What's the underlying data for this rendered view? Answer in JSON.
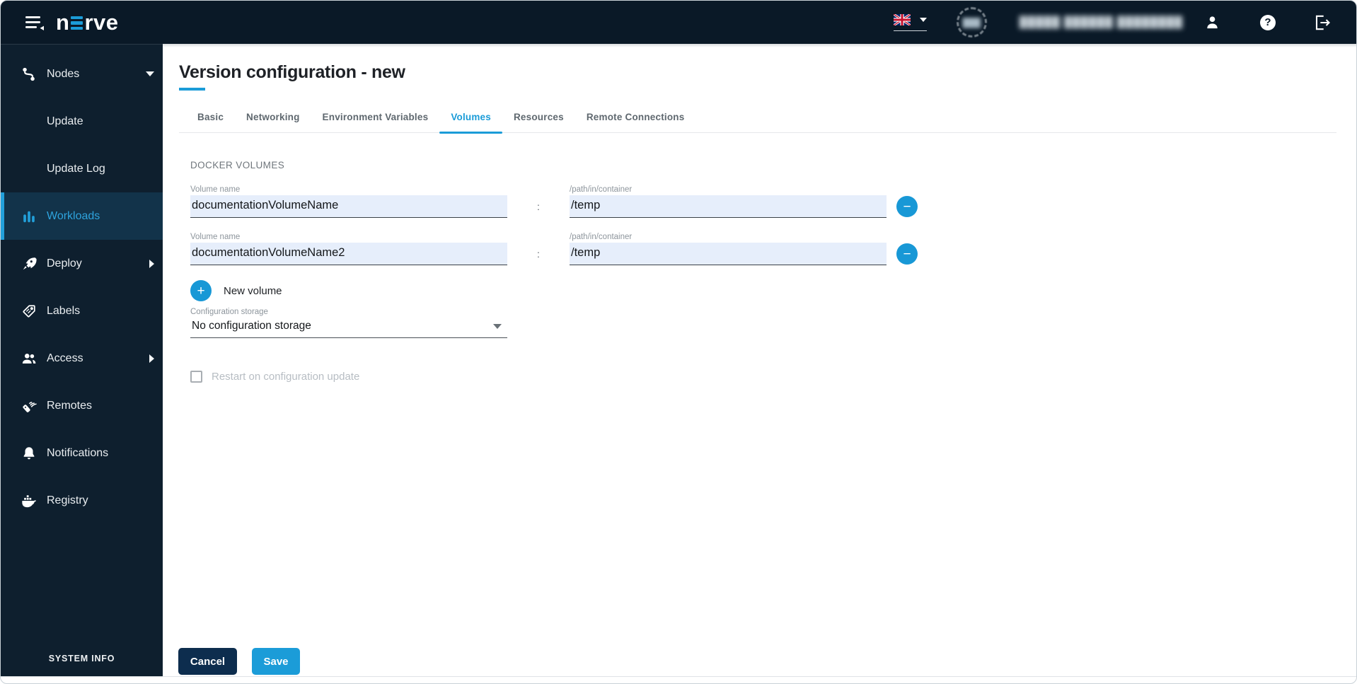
{
  "topbar": {
    "logo": {
      "prefix": "n",
      "suffix": "rve"
    },
    "language": {
      "flag_icon": "uk-flag"
    },
    "user": {
      "initials_obscured": "███",
      "name_obscured": "█████ ██████ ████████"
    }
  },
  "sidebar": {
    "items": [
      {
        "label": "Nodes",
        "icon": "nodes",
        "expanded": true
      },
      {
        "label": "Update",
        "child_of": "Nodes"
      },
      {
        "label": "Update Log",
        "child_of": "Nodes"
      },
      {
        "label": "Workloads",
        "icon": "workloads",
        "active": true
      },
      {
        "label": "Deploy",
        "icon": "deploy",
        "has_submenu": true
      },
      {
        "label": "Labels",
        "icon": "labels"
      },
      {
        "label": "Access",
        "icon": "access",
        "has_submenu": true
      },
      {
        "label": "Remotes",
        "icon": "remotes"
      },
      {
        "label": "Notifications",
        "icon": "notifications"
      },
      {
        "label": "Registry",
        "icon": "registry"
      }
    ],
    "footer": "SYSTEM INFO"
  },
  "page": {
    "title": "Version configuration - new",
    "tabs": [
      {
        "label": "Basic"
      },
      {
        "label": "Networking"
      },
      {
        "label": "Environment Variables"
      },
      {
        "label": "Volumes",
        "active": true
      },
      {
        "label": "Resources"
      },
      {
        "label": "Remote Connections"
      }
    ],
    "section_title": "DOCKER VOLUMES",
    "colon": ":",
    "volumes": [
      {
        "name_label": "Volume name",
        "name_value": "documentationVolumeName",
        "path_label": "/path/in/container",
        "path_value": "/temp"
      },
      {
        "name_label": "Volume name",
        "name_value": "documentationVolumeName2",
        "path_label": "/path/in/container",
        "path_value": "/temp"
      }
    ],
    "new_volume_label": "New volume",
    "config_storage": {
      "label": "Configuration storage",
      "value": "No configuration storage"
    },
    "restart_checkbox": {
      "label": "Restart on configuration update",
      "checked": false,
      "disabled": true
    },
    "buttons": {
      "cancel": "Cancel",
      "save": "Save"
    }
  },
  "colors": {
    "accent": "#1b9cd8",
    "topbar_bg": "#0a1927",
    "sidebar_bg": "#0e1f2e",
    "active_item_bg": "#12334a",
    "input_bg": "#e6eefb",
    "cancel_bg": "#0d2d4e"
  }
}
